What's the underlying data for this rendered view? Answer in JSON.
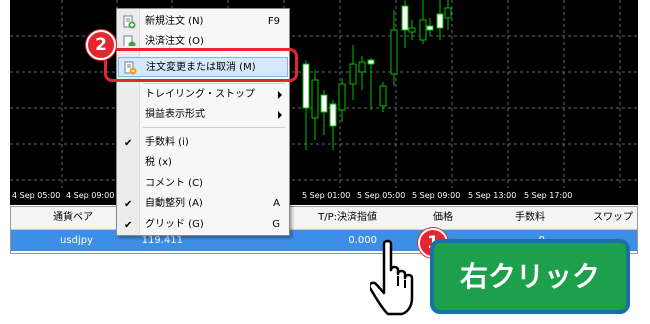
{
  "time_axis": [
    "4 Sep 05:00",
    "4 Sep 09:00",
    "5 Sep 01:00",
    "5 Sep 05:00",
    "5 Sep 09:00",
    "5 Sep 13:00",
    "5 Sep 17:00"
  ],
  "terminal": {
    "headers": [
      "通貨ペア",
      "T/P:決済指値",
      "価格",
      "手数料",
      "スワップ"
    ],
    "row": {
      "symbol": "usdjpy",
      "price_fragment": "119.411",
      "tp": "0.000",
      "commission": "0"
    }
  },
  "context_menu": {
    "items": [
      {
        "label": "新規注文 (N)",
        "shortcut": "F9",
        "icon": "new-order-icon"
      },
      {
        "label": "決済注文 (O)",
        "icon": "close-order-icon"
      },
      {
        "label": "注文変更または取消 (M)",
        "icon": "modify-order-icon",
        "highlighted": true
      },
      {
        "label": "トレイリング・ストップ",
        "submenu": true
      },
      {
        "label": "損益表示形式",
        "submenu": true
      },
      {
        "label": "手数料 (i)",
        "checked": true
      },
      {
        "label": "税 (x)"
      },
      {
        "label": "コメント (C)"
      },
      {
        "label": "自動整列 (A)",
        "shortcut": "A",
        "checked": true
      },
      {
        "label": "グリッド (G)",
        "shortcut": "G",
        "checked": true
      }
    ]
  },
  "annotations": {
    "step1": "1",
    "step2": "2",
    "callout": "右クリック"
  },
  "colors": {
    "chart_bg": "#000000",
    "candle": "#00c000",
    "selected_row": "#3d8ee6",
    "highlight_border": "#e3262f",
    "callout_bg": "#1ca04b",
    "callout_border": "#1b6fa8"
  }
}
